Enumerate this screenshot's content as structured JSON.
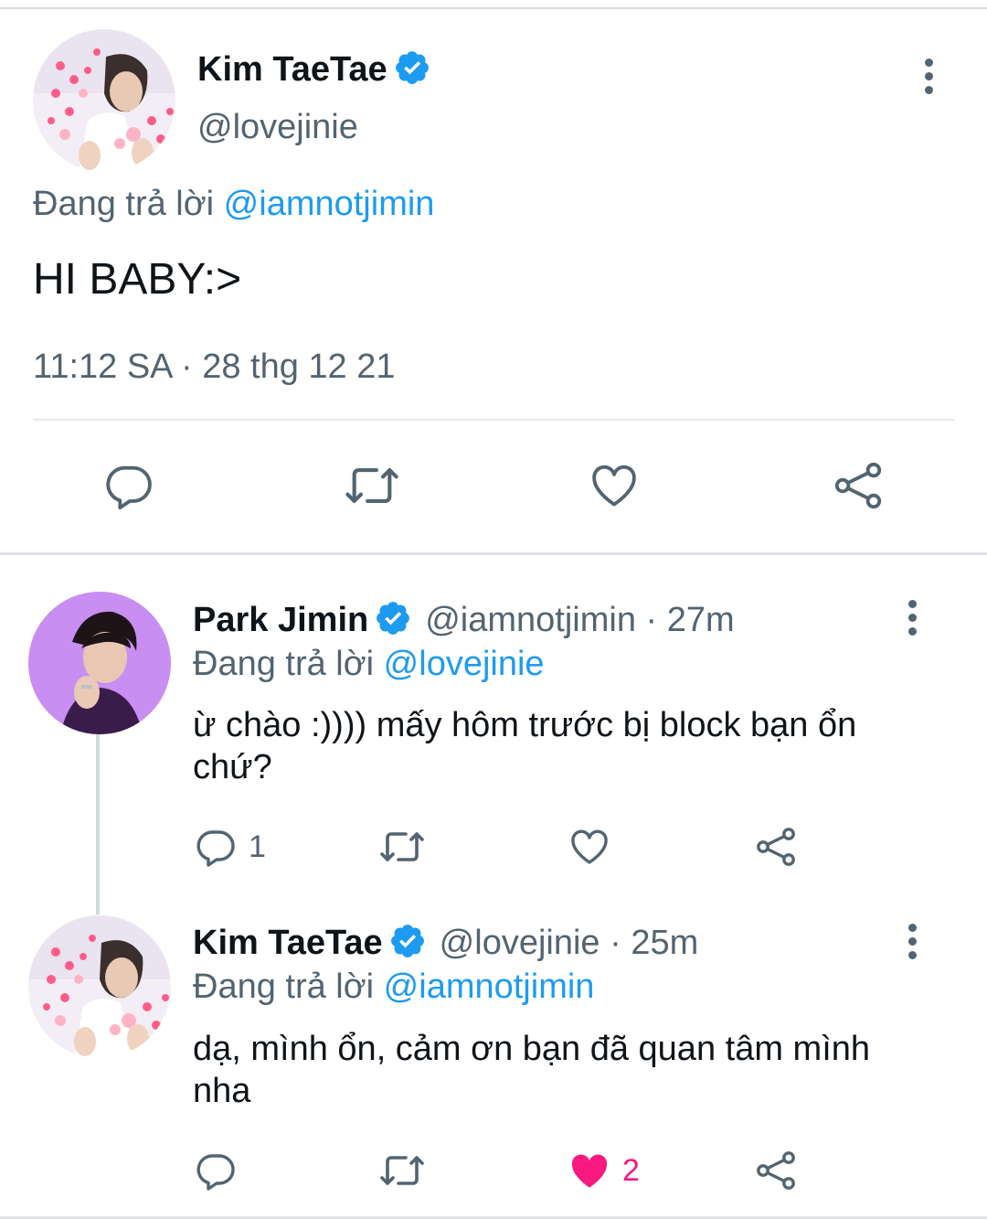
{
  "main_tweet": {
    "author_name": "Kim TaeTae",
    "handle": "@lovejinie",
    "replying_prefix": "Đang trả lời",
    "replying_to": "@iamnotjimin",
    "text": "HI BABY:>",
    "timestamp": "11:12 SA · 28 thg 12 21",
    "actions": [
      "reply-icon",
      "retweet-icon",
      "like-icon",
      "share-icon"
    ]
  },
  "replies": [
    {
      "author_name": "Park Jimin",
      "handle_time": "@iamnotjimin · 27m",
      "replying_prefix": "Đang trả lời",
      "replying_to": "@lovejinie",
      "text": "ừ chào :)))) mấy hôm trước bị block bạn ổn chứ?",
      "reply_count": "1",
      "like_count": "",
      "liked": false
    },
    {
      "author_name": "Kim TaeTae",
      "handle_time": "@lovejinie · 25m",
      "replying_prefix": "Đang trả lời",
      "replying_to": "@iamnotjimin",
      "text": "dạ, mình ổn, cảm ơn bạn đã quan tâm mình nha",
      "reply_count": "",
      "like_count": "2",
      "liked": true
    }
  ],
  "colors": {
    "accent": "#1d9bf0",
    "muted": "#536471",
    "like_active": "#f91880",
    "icon": "#536471"
  }
}
